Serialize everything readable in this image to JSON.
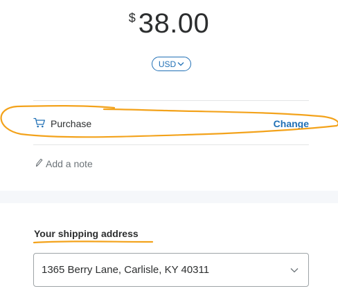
{
  "payment": {
    "currency_symbol": "$",
    "amount": "38.00",
    "currency_code": "USD"
  },
  "purchase": {
    "label": "Purchase",
    "change_label": "Change"
  },
  "note": {
    "label": "Add a note"
  },
  "shipping": {
    "label": "Your shipping address",
    "selected_address": "1365 Berry Lane, Carlisle, KY 40311"
  },
  "icons": {
    "cart": "cart-icon",
    "pencil": "pencil-icon",
    "chevron": "chevron-down-icon"
  },
  "colors": {
    "accent": "#1f6fb5",
    "annotation": "#f3a21a",
    "text": "#2c2e2f",
    "muted": "#6c7378"
  }
}
